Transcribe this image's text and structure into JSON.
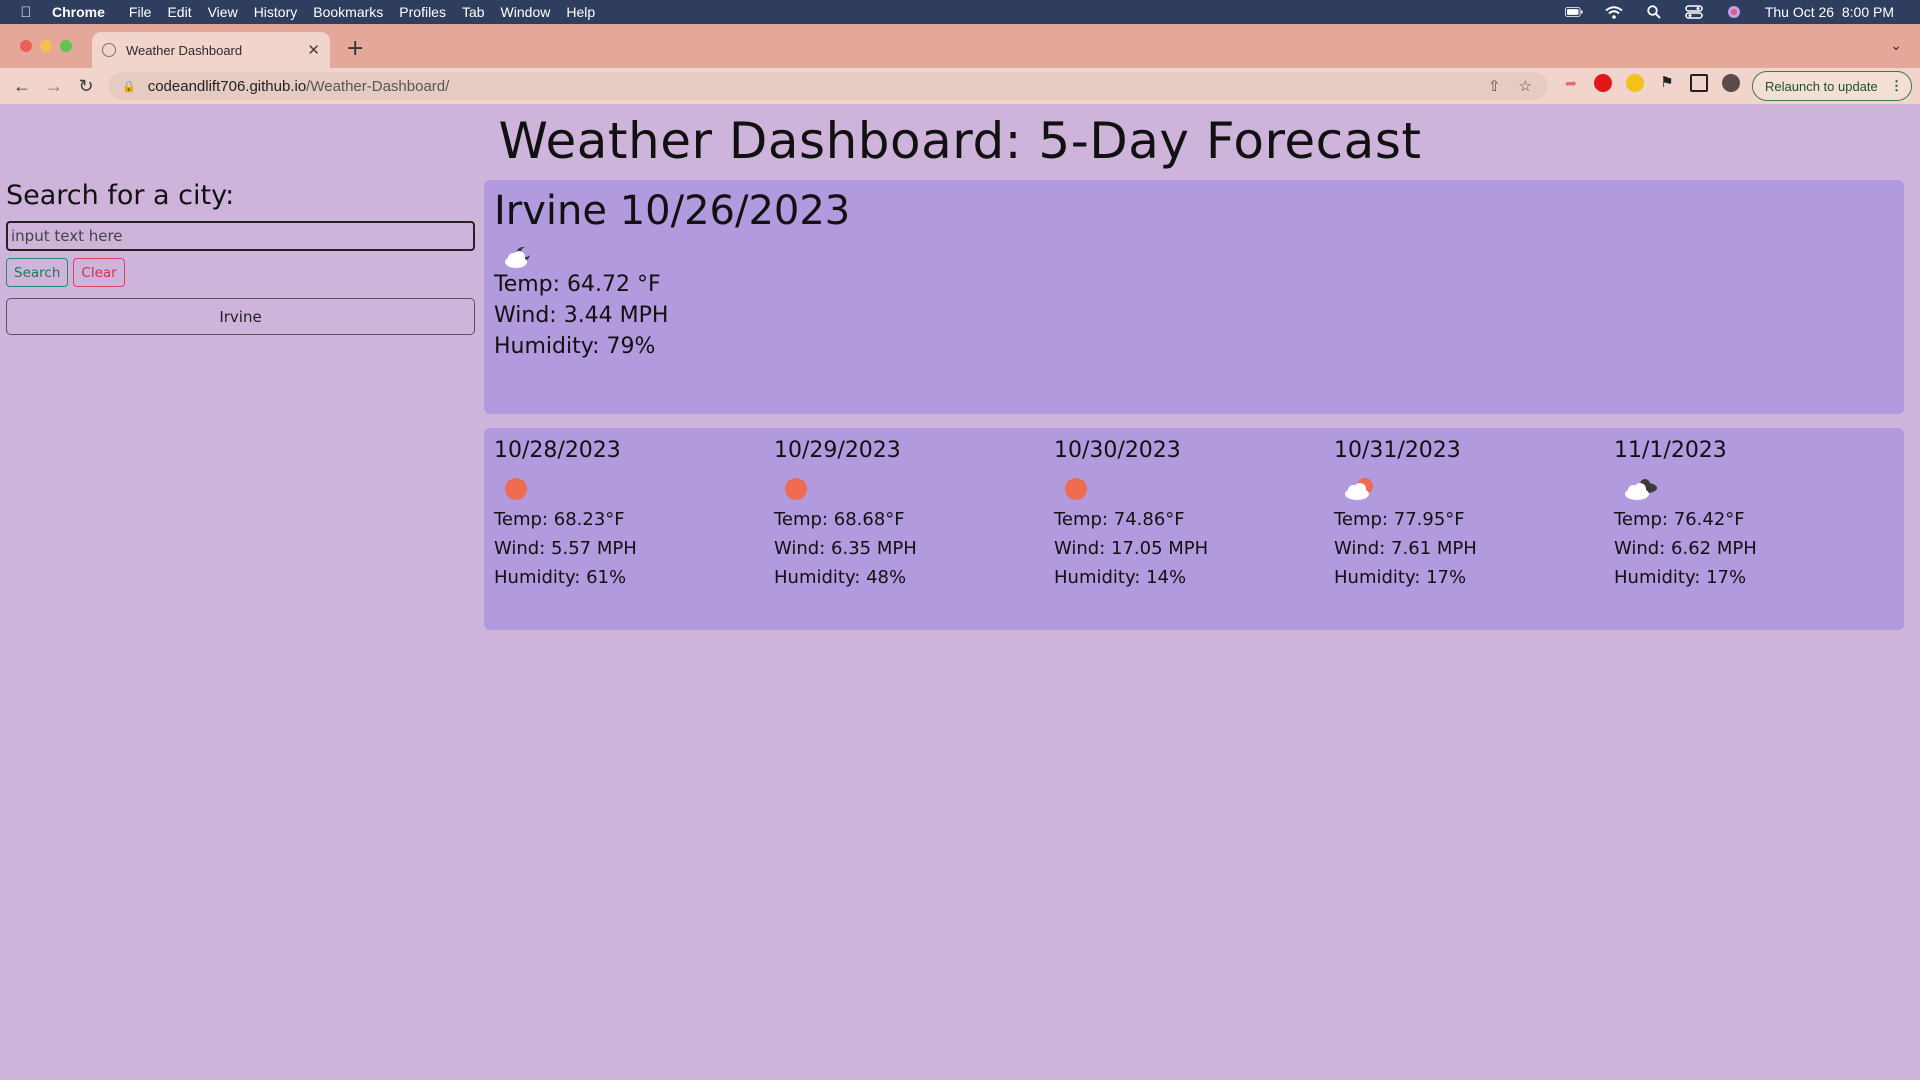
{
  "menubar": {
    "app": "Chrome",
    "items": [
      "File",
      "Edit",
      "View",
      "History",
      "Bookmarks",
      "Profiles",
      "Tab",
      "Window",
      "Help"
    ],
    "clock": "Thu Oct 26  8:00 PM"
  },
  "browser": {
    "tab_title": "Weather Dashboard",
    "url_host": "codeandlift706.github.io",
    "url_path": "/Weather-Dashboard/",
    "relaunch_label": "Relaunch to update"
  },
  "page": {
    "title": "Weather Dashboard: 5-Day Forecast"
  },
  "search": {
    "heading": "Search for a city:",
    "placeholder": "input text here",
    "search_label": "Search",
    "clear_label": "Clear",
    "history": [
      "Irvine"
    ]
  },
  "current": {
    "heading": "Irvine 10/26/2023",
    "icon": "night-cloud-icon",
    "temp": "Temp: 64.72 °F",
    "wind": "Wind: 3.44 MPH",
    "humidity": "Humidity: 79%"
  },
  "forecast": [
    {
      "date": "10/28/2023",
      "icon": "sun-icon",
      "temp": "Temp: 68.23°F",
      "wind": "Wind: 5.57 MPH",
      "humidity": "Humidity: 61%"
    },
    {
      "date": "10/29/2023",
      "icon": "sun-icon",
      "temp": "Temp: 68.68°F",
      "wind": "Wind: 6.35 MPH",
      "humidity": "Humidity: 48%"
    },
    {
      "date": "10/30/2023",
      "icon": "sun-icon",
      "temp": "Temp: 74.86°F",
      "wind": "Wind: 17.05 MPH",
      "humidity": "Humidity: 14%"
    },
    {
      "date": "10/31/2023",
      "icon": "partly-cloudy-icon",
      "temp": "Temp: 77.95°F",
      "wind": "Wind: 7.61 MPH",
      "humidity": "Humidity: 17%"
    },
    {
      "date": "11/1/2023",
      "icon": "broken-clouds-icon",
      "temp": "Temp: 76.42°F",
      "wind": "Wind: 6.62 MPH",
      "humidity": "Humidity: 17%"
    }
  ],
  "colors": {
    "page_bg": "#ceb4db",
    "card_bg": "#b19ade",
    "sun": "#ef6b4e",
    "search_accent": "#1c7a57",
    "clear_accent": "#d1304f"
  }
}
